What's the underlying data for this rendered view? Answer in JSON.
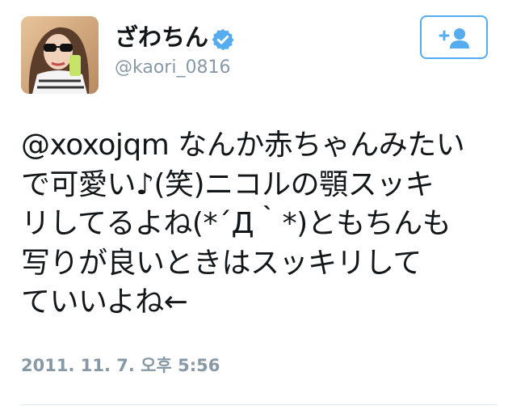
{
  "user": {
    "display_name": "ざわちん",
    "handle": "@kaori_0816",
    "verified": true,
    "avatar_icon": "profile-photo"
  },
  "follow_button": {
    "icon": "follow-user-plus-icon",
    "color": "#55acee"
  },
  "tweet": {
    "lines": [
      "@xoxojqm なんか赤ちゃんみたい",
      "で可愛い♪(笑)ニコルの顎スッキ",
      "リしてるよね(*´Д｀*)ともちんも",
      "写りが良いときはスッキリして",
      "ていいよね←"
    ],
    "timestamp": "2011. 11. 7. 오후 5:56"
  },
  "colors": {
    "text": "#14171a",
    "secondary": "#8899a6",
    "accent": "#55acee",
    "divider": "#e1e8ed"
  }
}
